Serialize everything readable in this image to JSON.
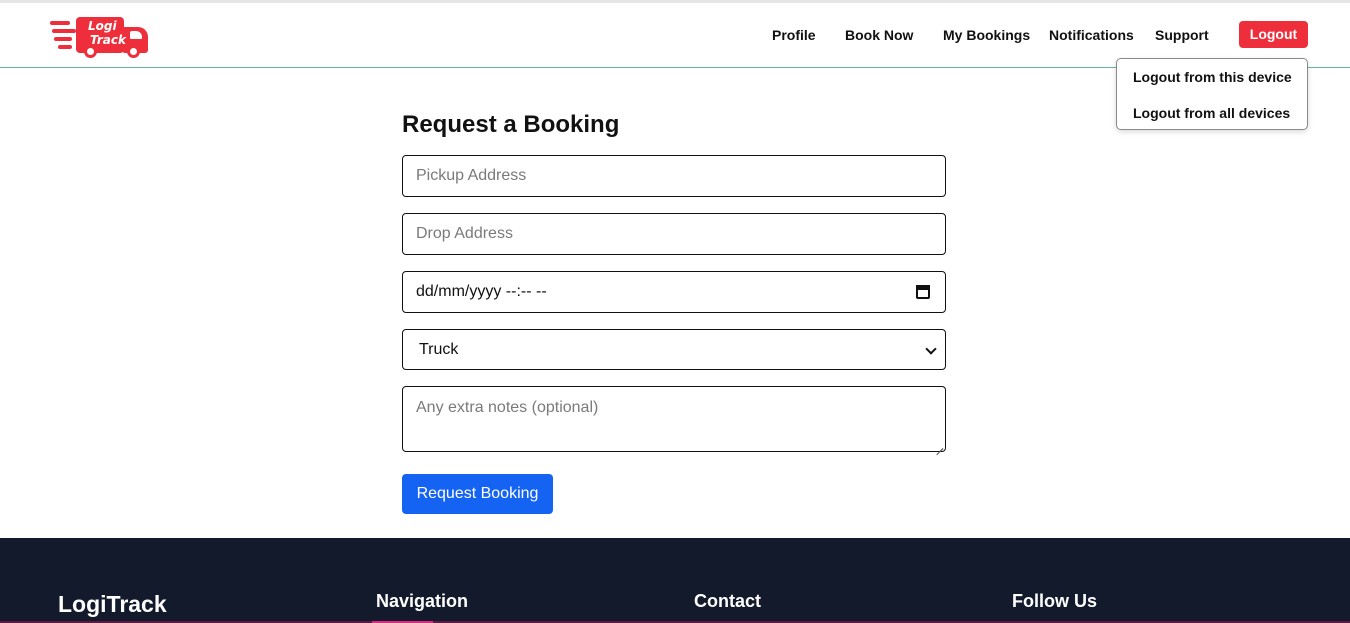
{
  "app": {
    "logo_text_line1": "Logi",
    "logo_text_line2": "Track"
  },
  "nav": {
    "items": [
      {
        "label": "Profile"
      },
      {
        "label": "Book Now"
      },
      {
        "label": "My Bookings"
      },
      {
        "label": "Notifications"
      },
      {
        "label": "Support"
      }
    ],
    "logout_label": "Logout"
  },
  "logout_menu": {
    "items": [
      {
        "label": "Logout from this device"
      },
      {
        "label": "Logout from all devices"
      }
    ]
  },
  "form": {
    "title": "Request a Booking",
    "pickup_placeholder": "Pickup Address",
    "drop_placeholder": "Drop Address",
    "datetime_value": "dd/mm/yyyy --:-- --",
    "vehicle_selected": "Truck",
    "notes_placeholder": "Any extra notes (optional)",
    "submit_label": "Request Booking"
  },
  "footer": {
    "brand": "LogiTrack",
    "headings": [
      "Navigation",
      "Contact",
      "Follow Us"
    ]
  },
  "colors": {
    "brand_red": "#ee2f3b",
    "primary_blue": "#1463f3",
    "footer_bg": "#121a2c",
    "header_divider": "#5fb99c"
  }
}
